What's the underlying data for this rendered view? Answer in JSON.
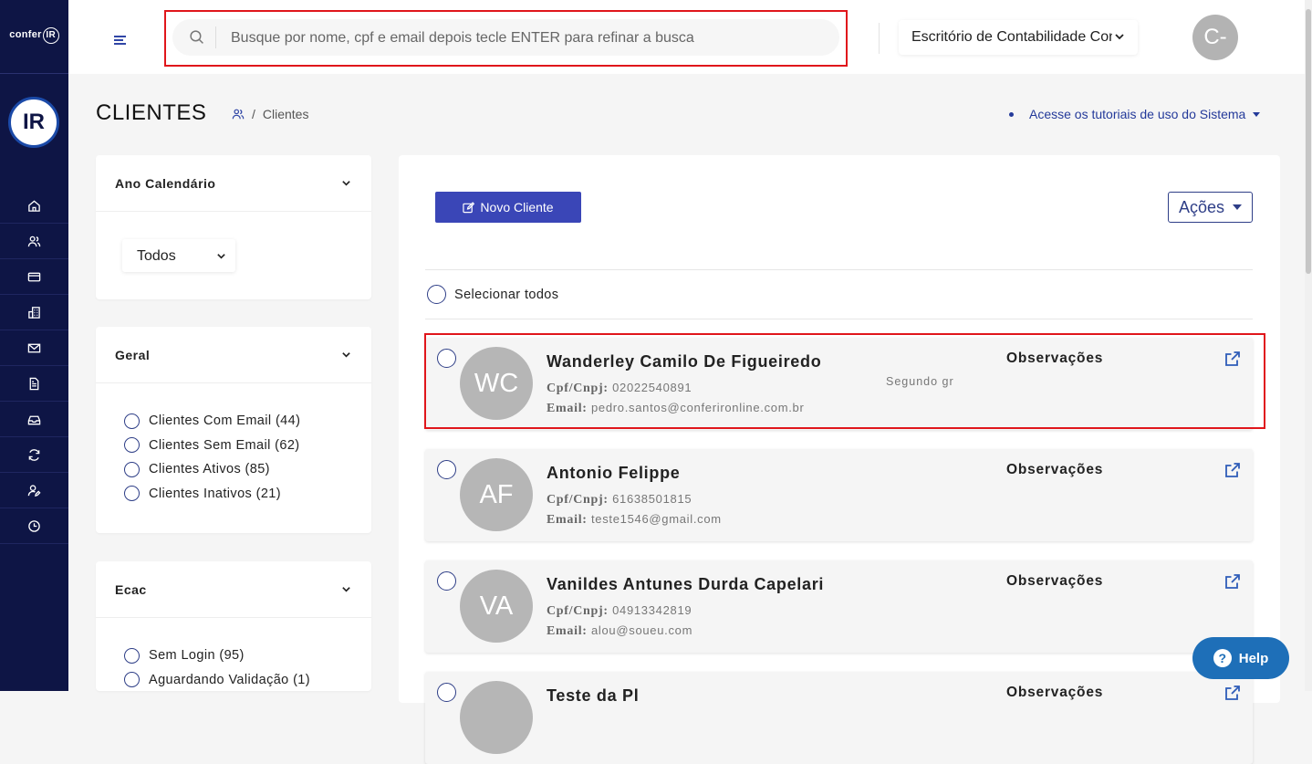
{
  "brand": {
    "logo_text": "confer",
    "logo_badge": "IR",
    "badge_text": "IR"
  },
  "topbar": {
    "search_placeholder": "Busque por nome, cpf e email depois tecle ENTER para refinar a busca",
    "office_selected": "Escritório de Contabilidade Cont",
    "user_initials": "C-"
  },
  "sidebar": {
    "items": [
      {
        "icon": "home-icon"
      },
      {
        "icon": "users-icon"
      },
      {
        "icon": "card-icon"
      },
      {
        "icon": "buildings-icon"
      },
      {
        "icon": "mail-icon"
      },
      {
        "icon": "document-icon"
      },
      {
        "icon": "inbox-icon"
      },
      {
        "icon": "sync-icon"
      },
      {
        "icon": "user-edit-icon"
      },
      {
        "icon": "clock-icon"
      }
    ]
  },
  "page": {
    "title": "CLIENTES",
    "breadcrumb_sep": "/",
    "breadcrumb_current": "Clientes",
    "tutorial_link": "Acesse os tutoriais de uso do Sistema"
  },
  "filters": {
    "ano": {
      "title": "Ano Calendário",
      "selected": "Todos"
    },
    "geral": {
      "title": "Geral",
      "options": [
        {
          "label": "Clientes Com Email (44)"
        },
        {
          "label": "Clientes Sem Email (62)"
        },
        {
          "label": "Clientes Ativos (85)"
        },
        {
          "label": "Clientes Inativos (21)"
        }
      ]
    },
    "ecac": {
      "title": "Ecac",
      "options": [
        {
          "label": "Sem Login (95)"
        },
        {
          "label": "Aguardando Validação (1)"
        }
      ]
    }
  },
  "main": {
    "new_client_label": "Novo Cliente",
    "actions_label": "Ações",
    "select_all_label": "Selecionar todos",
    "cpf_label": "Cpf/Cnpj:",
    "email_label": "Email:",
    "obs_label": "Observações",
    "clients": [
      {
        "initials": "WC",
        "name": "Wanderley Camilo De Figueiredo",
        "cpf": "02022540891",
        "email": "pedro.santos@conferironline.com.br",
        "note": "Segundo gr"
      },
      {
        "initials": "AF",
        "name": "Antonio Felippe",
        "cpf": "61638501815",
        "email": "teste1546@gmail.com",
        "note": ""
      },
      {
        "initials": "VA",
        "name": "Vanildes Antunes Durda Capelari",
        "cpf": "04913342819",
        "email": "alou@soueu.com",
        "note": ""
      },
      {
        "initials": "",
        "name": "Teste da Pl",
        "cpf": "",
        "email": "",
        "note": ""
      }
    ]
  },
  "help": {
    "label": "Help",
    "icon_char": "?"
  },
  "colors": {
    "sidebar": "#0e1545",
    "accent": "#3a46b7",
    "highlight": "#e0161b",
    "help": "#1e6fb8"
  }
}
